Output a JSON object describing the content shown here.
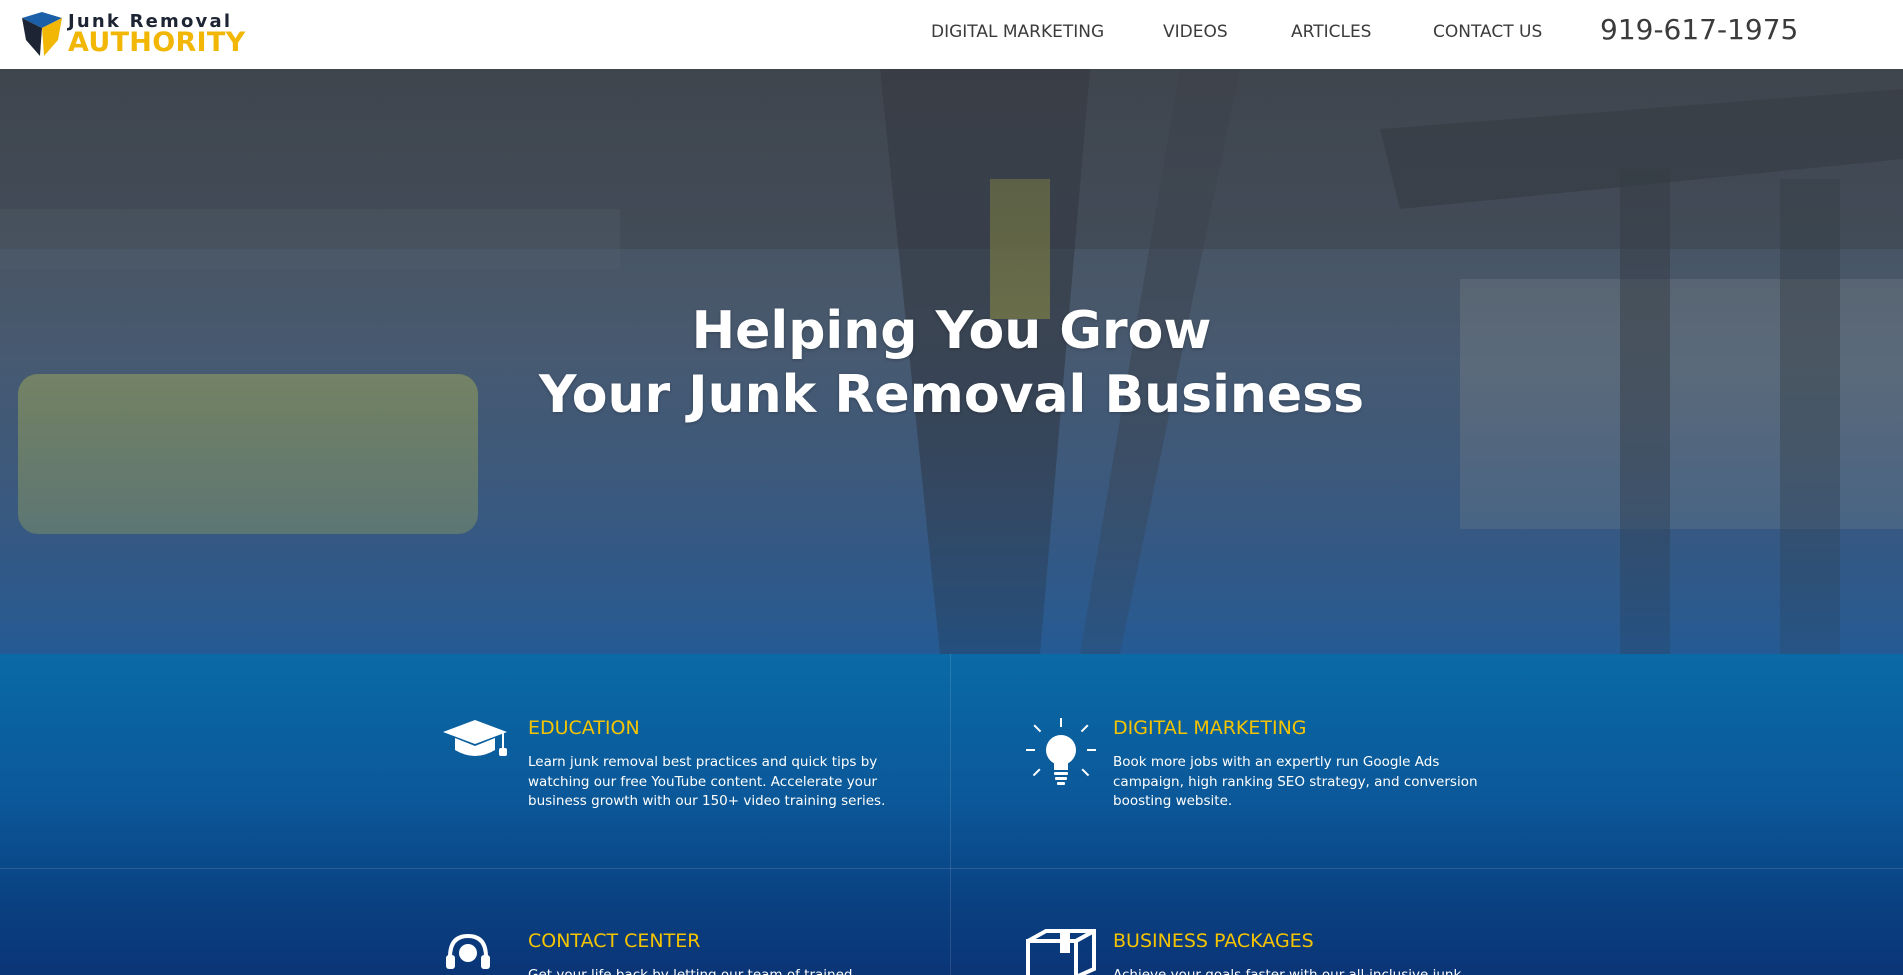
{
  "brand": {
    "logo_line1": "Junk Removal",
    "logo_line2": "AUTHORITY",
    "accent_color": "#f2b705",
    "dark_color": "#1d2433"
  },
  "nav": {
    "items": [
      {
        "label": "DIGITAL MARKETING"
      },
      {
        "label": "VIDEOS"
      },
      {
        "label": "ARTICLES"
      },
      {
        "label": "CONTACT US"
      }
    ],
    "phone": "919-617-1975"
  },
  "hero": {
    "title_line1": "Helping You Grow",
    "title_line2": "Your Junk Removal Business"
  },
  "services": {
    "title_color": "#f5c400",
    "items": [
      {
        "icon": "graduation-cap-icon",
        "title": "EDUCATION",
        "description": "Learn junk removal best practices and quick tips by watching our free YouTube content. Accelerate your business growth with our 150+ video training series."
      },
      {
        "icon": "lightbulb-icon",
        "title": "DIGITAL MARKETING",
        "description": "Book more jobs with an expertly run Google Ads campaign, high ranking SEO strategy, and conversion boosting website."
      },
      {
        "icon": "headset-icon",
        "title": "CONTACT CENTER",
        "description": "Get your life back by letting our team of trained"
      },
      {
        "icon": "package-box-icon",
        "title": "BUSINESS PACKAGES",
        "description": "Achieve your goals faster with our all-inclusive junk"
      }
    ]
  }
}
